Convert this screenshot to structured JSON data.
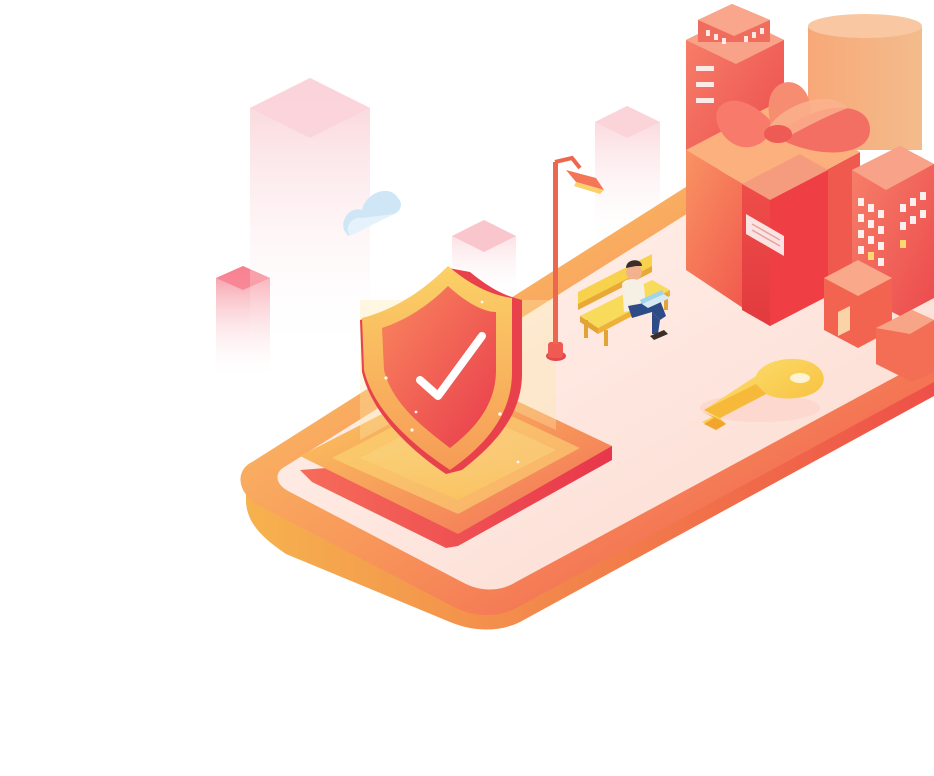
{
  "scene": {
    "kind": "isometric-security-illustration",
    "elements": [
      "phone-platform",
      "security-shield-with-checkmark",
      "street-lamp",
      "bench-with-person-using-laptop",
      "gift-box-with-bow",
      "golden-key",
      "city-buildings",
      "cloud"
    ]
  },
  "colors": {
    "primary_red": "#f0424a",
    "coral": "#f7776a",
    "orange": "#f9a05a",
    "gold": "#f7c94a",
    "pale_pink": "#fde6e1",
    "cloud_blue": "#cfe6f7",
    "background": "#ffffff"
  }
}
